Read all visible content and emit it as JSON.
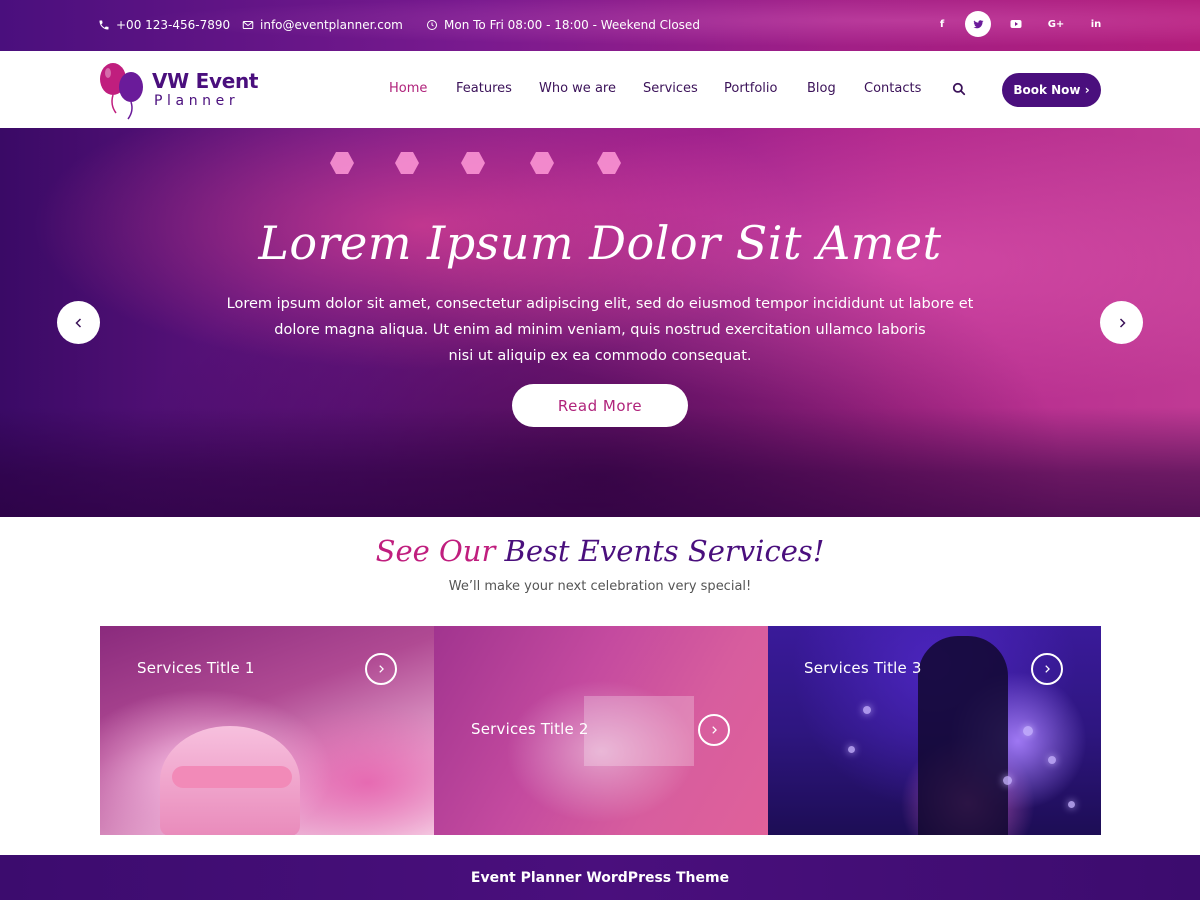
{
  "topbar": {
    "phone": "+00 123-456-7890",
    "email": "info@eventplanner.com",
    "hours": "Mon To Fri 08:00 - 18:00 - Weekend Closed",
    "social": [
      {
        "icon": "facebook-icon",
        "glyph": "f"
      },
      {
        "icon": "twitter-icon",
        "glyph": "t"
      },
      {
        "icon": "youtube-icon",
        "glyph": "▶"
      },
      {
        "icon": "google-plus-icon",
        "glyph": "G+"
      },
      {
        "icon": "linkedin-icon",
        "glyph": "in"
      }
    ]
  },
  "header": {
    "logo_title": "VW Event",
    "logo_sub": "Planner",
    "nav": [
      "Home",
      "Features",
      "Who we are",
      "Services",
      "Portfolio",
      "Blog",
      "Contacts"
    ],
    "active_nav": "Home",
    "book_label": "Book Now ›"
  },
  "hero": {
    "title": "Lorem Ipsum Dolor Sit Amet",
    "text_lines": [
      "Lorem ipsum dolor sit amet, consectetur adipiscing elit, sed do eiusmod tempor incididunt ut labore et",
      "dolore magna aliqua.  Ut enim ad minim veniam, quis nostrud exercitation ullamco laboris",
      "nisi ut aliquip ex ea commodo consequat."
    ],
    "button_label": "Read More"
  },
  "services": {
    "title_part1": "See Our",
    "title_part2": "Best Events Services!",
    "subtitle": "We’ll make your next celebration very special!",
    "cards": [
      {
        "title": "Services Title 1"
      },
      {
        "title": "Services Title 2"
      },
      {
        "title": "Services Title 3"
      }
    ]
  },
  "footer": {
    "text": "Event Planner WordPress Theme"
  },
  "colors": {
    "brand_purple": "#4a0f7d",
    "accent_pink": "#c01e7e"
  }
}
